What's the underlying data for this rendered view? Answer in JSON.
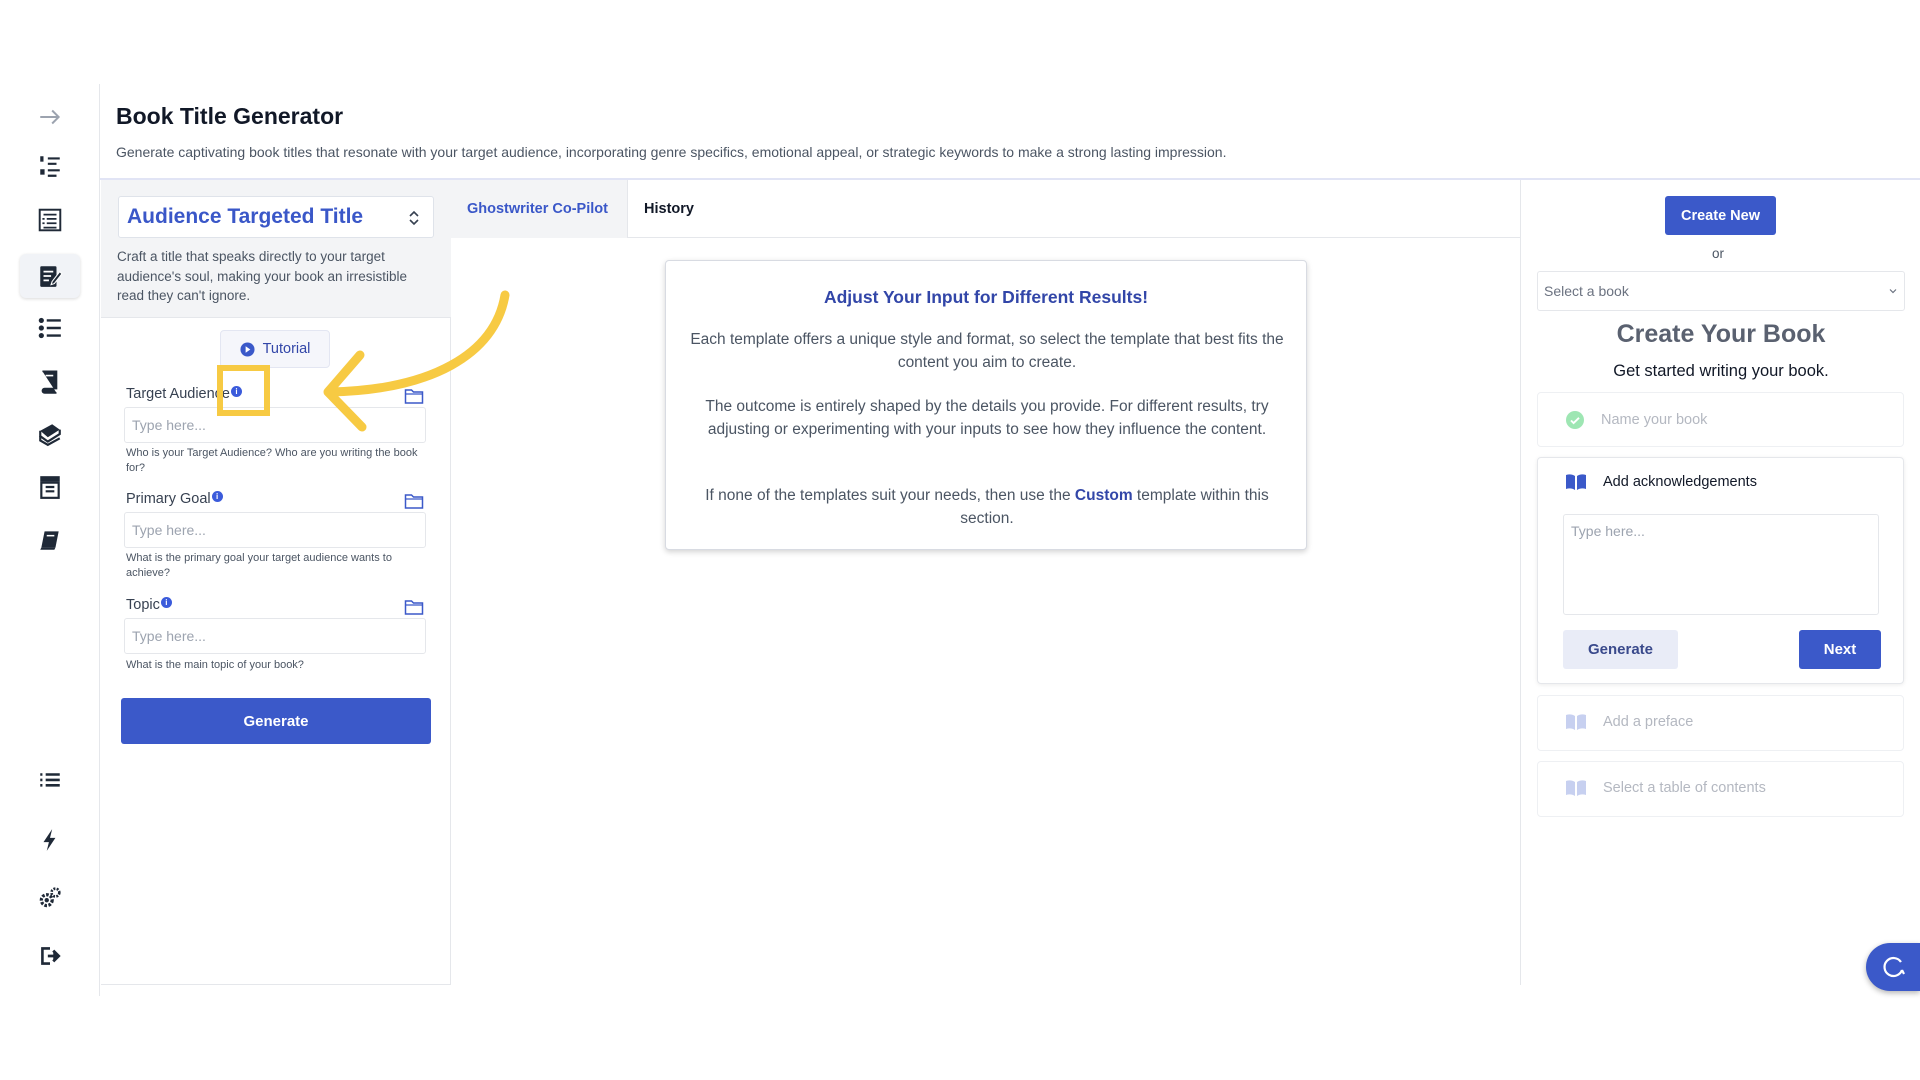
{
  "header": {
    "title": "Book Title Generator",
    "description": "Generate captivating book titles that resonate with your target audience, incorporating genre specifics, emotional appeal, or strategic keywords to make a strong lasting impression."
  },
  "rail": {
    "icons": [
      "arrow-right-icon",
      "numbered-list-icon",
      "outline-icon",
      "edit-book-icon",
      "bullet-list-icon",
      "book-stack-icon",
      "books-icon",
      "archive-icon",
      "notebook-icon",
      "list-icon",
      "bolt-icon",
      "settings-icon",
      "logout-icon"
    ],
    "active": "edit-book-icon"
  },
  "form": {
    "template_label": "Audience Targeted Title",
    "template_desc": "Craft a title that speaks directly to your target audience's soul, making your book an irresistible read they can't ignore.",
    "tutorial_label": "Tutorial",
    "fields": [
      {
        "label": "Target Audience",
        "placeholder": "Type here...",
        "help": "Who is your Target Audience? Who are you writing the book for?"
      },
      {
        "label": "Primary Goal",
        "placeholder": "Type here...",
        "help": "What is the primary goal your target audience wants to achieve?"
      },
      {
        "label": "Topic",
        "placeholder": "Type here...",
        "help": "What is the main topic of your book?"
      }
    ],
    "generate_label": "Generate"
  },
  "tabs": [
    {
      "label": "Ghostwriter Co-Pilot",
      "active": true
    },
    {
      "label": "History",
      "active": false
    }
  ],
  "info_card": {
    "title": "Adjust Your Input for Different Results!",
    "p1": "Each template offers a unique style and format, so select the template that best fits the content you aim to create.",
    "p2": "The outcome is entirely shaped by the details you provide. For different results, try adjusting or experimenting with your inputs to see how they influence the content.",
    "p3_before": "If none of the templates suit your needs, then use the ",
    "p3_link": "Custom",
    "p3_after": " template within this section."
  },
  "right": {
    "create_new_label": "Create New",
    "or_label": "or",
    "book_select_placeholder": "Select a book",
    "title": "Create Your Book",
    "subtitle": "Get started writing your book.",
    "steps": [
      {
        "label": "Name your book",
        "state": "done"
      },
      {
        "label": "Add acknowledgements",
        "state": "active"
      },
      {
        "label": "Add a preface",
        "state": "pending"
      },
      {
        "label": "Select a table of contents",
        "state": "pending"
      }
    ],
    "ack_placeholder": "Type here...",
    "ack_generate_label": "Generate",
    "ack_next_label": "Next"
  },
  "colors": {
    "primary": "#3b59c9",
    "highlight": "#f7ca43",
    "success": "#9ee6b3"
  }
}
